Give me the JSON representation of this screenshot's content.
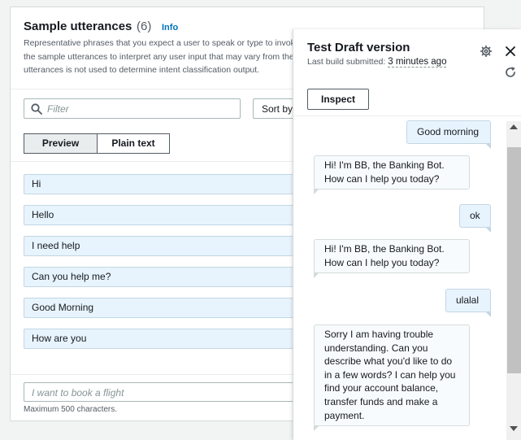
{
  "utterances_panel": {
    "title": "Sample utterances",
    "count": "(6)",
    "info_label": "Info",
    "description": "Representative phrases that you expect a user to speak or type to invoke the sample utterances to interpret any user input that may vary from the utterances is not used to determine intent classification output.",
    "filter_placeholder": "Filter",
    "sort_label": "Sort by",
    "tabs": [
      "Preview",
      "Plain text"
    ],
    "items": [
      "Hi",
      "Hello",
      "I need help",
      "Can you help me?",
      "Good Morning",
      "How are you"
    ],
    "new_placeholder": "I want to book a flight",
    "max_chars": "Maximum 500 characters."
  },
  "test_panel": {
    "title": "Test Draft version",
    "build_label": "Last build submitted:",
    "build_time": "3 minutes ago",
    "inspect_label": "Inspect",
    "messages": [
      {
        "from": "user",
        "text": "Good morning"
      },
      {
        "from": "bot",
        "text": "Hi! I'm BB, the Banking Bot. How can I help you today?"
      },
      {
        "from": "user",
        "text": "ok"
      },
      {
        "from": "bot",
        "text": "Hi! I'm BB, the Banking Bot. How can I help you today?"
      },
      {
        "from": "user",
        "text": "ulalal"
      },
      {
        "from": "bot",
        "text": "Sorry I am having trouble understanding. Can you describe what you'd like to do in a few words? I can help you find your account balance, transfer funds and make a payment."
      }
    ]
  },
  "icons": [
    "search-icon",
    "gear-icon",
    "close-icon",
    "refresh-icon"
  ],
  "colors": {
    "link": "#0073bb",
    "user_bubble": "#e8f4fd",
    "border": "#d5dbdb"
  }
}
